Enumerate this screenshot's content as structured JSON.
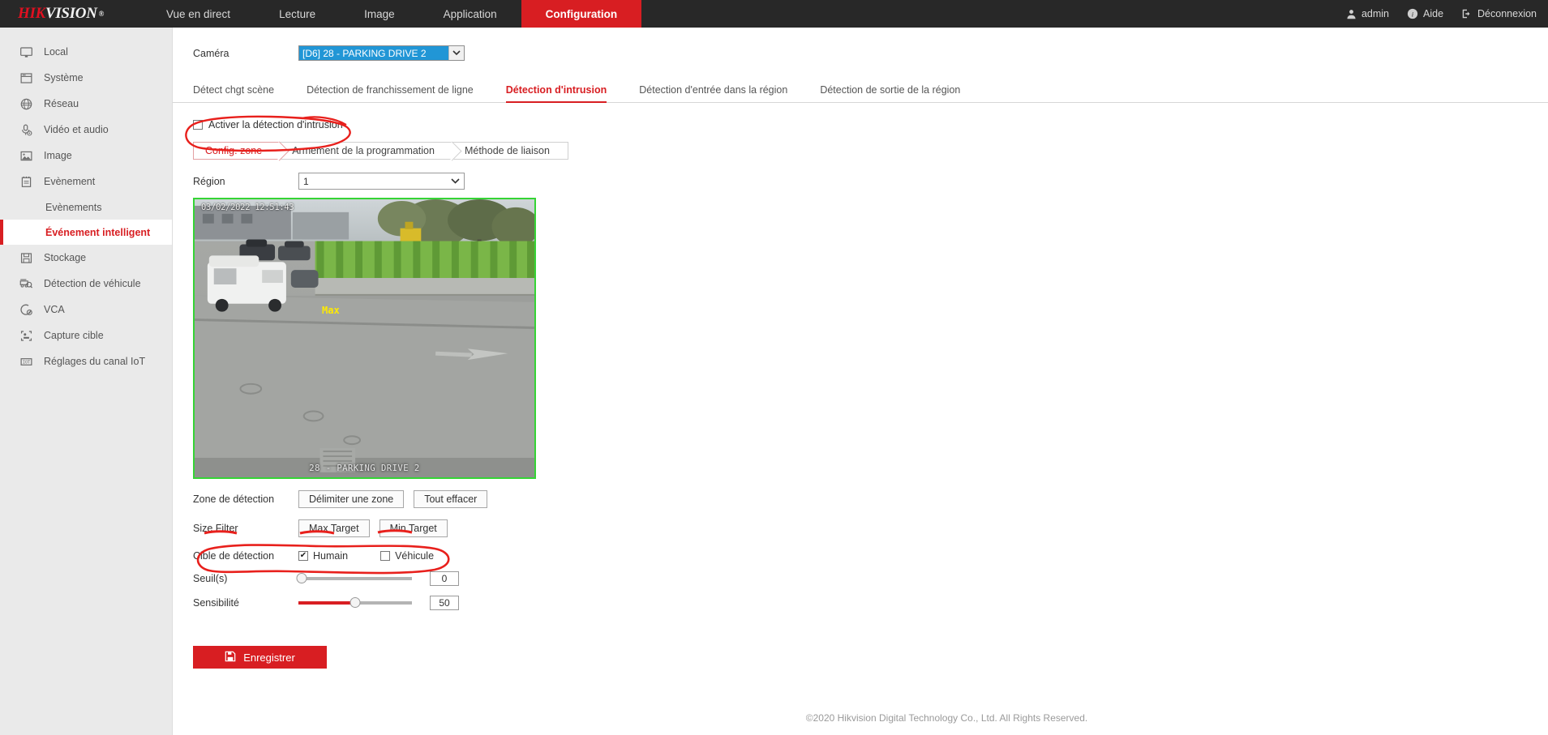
{
  "brand": {
    "part1": "HIK",
    "part2": "VISION",
    "reg": "®"
  },
  "topnav": [
    {
      "label": "Vue en direct",
      "active": false
    },
    {
      "label": "Lecture",
      "active": false
    },
    {
      "label": "Image",
      "active": false
    },
    {
      "label": "Application",
      "active": false
    },
    {
      "label": "Configuration",
      "active": true
    }
  ],
  "topright": {
    "user": "admin",
    "help": "Aide",
    "logout": "Déconnexion"
  },
  "sidebar": {
    "items": [
      {
        "label": "Local",
        "icon": "monitor-icon"
      },
      {
        "label": "Système",
        "icon": "window-icon"
      },
      {
        "label": "Réseau",
        "icon": "globe-icon"
      },
      {
        "label": "Vidéo et audio",
        "icon": "microphone-icon"
      },
      {
        "label": "Image",
        "icon": "picture-icon"
      },
      {
        "label": "Evènement",
        "icon": "clipboard-icon"
      }
    ],
    "subitems": [
      {
        "label": "Evènements",
        "active": false
      },
      {
        "label": "Événement intelligent",
        "active": true
      }
    ],
    "items2": [
      {
        "label": "Stockage",
        "icon": "floppy-disk-icon"
      },
      {
        "label": "Détection de véhicule",
        "icon": "vehicle-search-icon"
      },
      {
        "label": "VCA",
        "icon": "vca-icon"
      },
      {
        "label": "Capture cible",
        "icon": "target-capture-icon"
      },
      {
        "label": "Réglages du canal IoT",
        "icon": "iot-icon"
      }
    ]
  },
  "main": {
    "camera_label": "Caméra",
    "camera_value": "[D6] 28 - PARKING DRIVE 2",
    "tabs": [
      {
        "label": "Détect chgt scène",
        "active": false
      },
      {
        "label": "Détection de franchissement de ligne",
        "active": false
      },
      {
        "label": "Détection d'intrusion",
        "active": true
      },
      {
        "label": "Détection d'entrée dans la région",
        "active": false
      },
      {
        "label": "Détection de sortie de la région",
        "active": false
      }
    ],
    "enable_label": "Activer la détection d'intrusion",
    "enable_checked": false,
    "subtabs": [
      {
        "label": "Config. zone",
        "active": true
      },
      {
        "label": "Armement de la programmation",
        "active": false
      },
      {
        "label": "Méthode de liaison",
        "active": false
      }
    ],
    "region_label": "Région",
    "region_value": "1",
    "video": {
      "timestamp": "03/02/2022 12:51:43",
      "channel_overlay": "28 - PARKING DRIVE 2",
      "max_label": "Max"
    },
    "zone_label": "Zone de détection",
    "zone_draw_btn": "Délimiter une zone",
    "zone_clear_btn": "Tout effacer",
    "size_filter_label": "Size Filter",
    "max_target_btn": "Max Target",
    "min_target_btn": "Min Target",
    "target_label": "Cible de détection",
    "target_human": "Humain",
    "target_human_checked": true,
    "target_vehicle": "Véhicule",
    "target_vehicle_checked": false,
    "threshold_label": "Seuil(s)",
    "threshold_value": "0",
    "sensitivity_label": "Sensibilité",
    "sensitivity_value": "50",
    "save_label": "Enregistrer"
  },
  "footer": "©2020 Hikvision Digital Technology Co., Ltd. All Rights Reserved.",
  "colors": {
    "accent": "#d81e22",
    "topbar": "#282828",
    "sidebar": "#eaeaea",
    "selection": "#2196d6",
    "video_border": "#35d435",
    "annotation": "#e8201c"
  }
}
